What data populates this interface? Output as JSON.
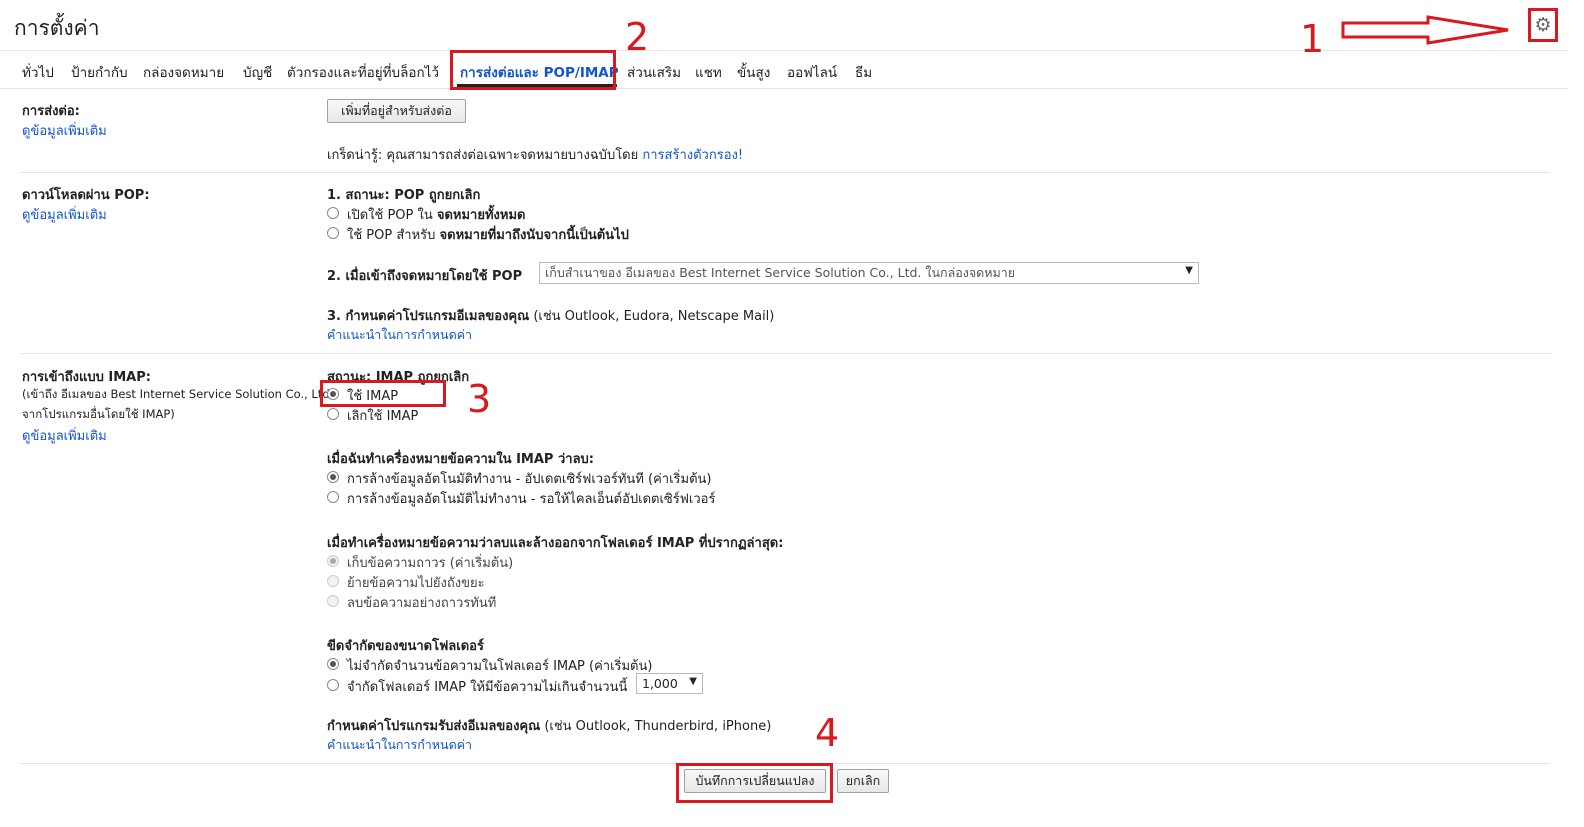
{
  "header": {
    "title": "การตั้งค่า",
    "settings_icon": "gear-icon"
  },
  "annotations": {
    "step1": "1",
    "step2": "2",
    "step3": "3",
    "step4": "4",
    "accent_color": "#d8191f"
  },
  "tabs": [
    {
      "label": "ทั่วไป"
    },
    {
      "label": "ป้ายกำกับ"
    },
    {
      "label": "กล่องจดหมาย"
    },
    {
      "label": "บัญชี"
    },
    {
      "label": "ตัวกรองและที่อยู่ที่บล็อกไว้"
    },
    {
      "label": "การส่งต่อและ POP/IMAP",
      "active": true
    },
    {
      "label": "ส่วนเสริม"
    },
    {
      "label": "แชท"
    },
    {
      "label": "ขั้นสูง"
    },
    {
      "label": "ออฟไลน์"
    },
    {
      "label": "ธีม"
    }
  ],
  "forwarding": {
    "label": "การส่งต่อ:",
    "learn_more": "ดูข้อมูลเพิ่มเติม",
    "add_button": "เพิ่มที่อยู่สำหรับส่งต่อ",
    "tip_prefix": "เกร็ดน่ารู้: คุณสามารถส่งต่อเฉพาะจดหมายบางฉบับโดย",
    "tip_link": "การสร้างตัวกรอง!"
  },
  "pop": {
    "label": "ดาวน์โหลดผ่าน POP:",
    "learn_more": "ดูข้อมูลเพิ่มเติม",
    "status": "1. สถานะ: POP ถูกยกเลิก",
    "opt1_prefix": "เปิดใช้ POP ใน",
    "opt1_bold": "จดหมายทั้งหมด",
    "opt2_prefix": "ใช้ POP สำหรับ",
    "opt2_bold": "จดหมายที่มาถึงนับจากนี้เป็นต้นไป",
    "when_label": "2. เมื่อเข้าถึงจดหมายโดยใช้ POP",
    "when_value": "เก็บสำเนาของ อีเมลของ Best Internet Service Solution Co., Ltd. ในกล่องจดหมาย",
    "config_bold": "3. กำหนดค่าโปรแกรมอีเมลของคุณ",
    "config_rest": "(เช่น Outlook, Eudora, Netscape Mail)",
    "config_link": "คำแนะนำในการกำหนดค่า"
  },
  "imap": {
    "label": "การเข้าถึงแบบ IMAP:",
    "desc1": "(เข้าถึง อีเมลของ Best Internet Service Solution Co., Ltd.",
    "desc2": "จากโปรแกรมอื่นโดยใช้ IMAP)",
    "learn_more": "ดูข้อมูลเพิ่มเติม",
    "status": "สถานะ: IMAP ถูกยกเลิก",
    "enable": "ใช้ IMAP",
    "disable": "เลิกใช้ IMAP",
    "expunge_title": "เมื่อฉันทำเครื่องหมายข้อความใน IMAP ว่าลบ:",
    "expunge_on": "การล้างข้อมูลอัตโนมัติทำงาน - อัปเดตเซิร์ฟเวอร์ทันที (ค่าเริ่มต้น)",
    "expunge_off": "การล้างข้อมูลอัตโนมัติไม่ทำงาน - รอให้ไคลเอ็นต์อัปเดตเซิร์ฟเวอร์",
    "deleted_title": "เมื่อทำเครื่องหมายข้อความว่าลบและล้างออกจากโฟลเดอร์ IMAP ที่ปรากฏล่าสุด:",
    "deleted_archive": "เก็บข้อความถาวร (ค่าเริ่มต้น)",
    "deleted_trash": "ย้ายข้อความไปยังถังขยะ",
    "deleted_delete": "ลบข้อความอย่างถาวรทันที",
    "folder_title": "ขีดจำกัดของขนาดโฟลเดอร์",
    "folder_unlimited": "ไม่จำกัดจำนวนข้อความในโฟลเดอร์ IMAP (ค่าเริ่มต้น)",
    "folder_limit": "จำกัดโฟลเดอร์ IMAP ให้มีข้อความไม่เกินจำนวนนี้",
    "folder_limit_value": "1,000",
    "client_bold": "กำหนดค่าโปรแกรมรับส่งอีเมลของคุณ",
    "client_rest": "(เช่น Outlook, Thunderbird, iPhone)",
    "client_link": "คำแนะนำในการกำหนดค่า"
  },
  "footer": {
    "save": "บันทึกการเปลี่ยนแปลง",
    "cancel": "ยกเลิก"
  }
}
